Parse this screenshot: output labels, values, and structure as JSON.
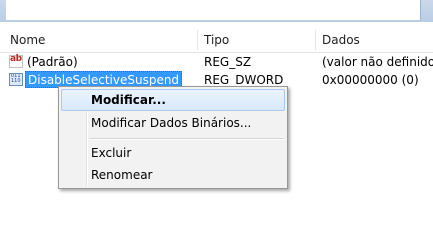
{
  "columns": {
    "name": "Nome",
    "type": "Tipo",
    "data": "Dados"
  },
  "rows": [
    {
      "name": "(Padrão)",
      "type": "REG_SZ",
      "data": "(valor não definido)",
      "icon": "string-value-icon",
      "icon_text": "ab"
    },
    {
      "name": "DisableSelectiveSuspend",
      "type": "REG_DWORD",
      "data": "0x00000000 (0)",
      "icon": "binary-value-icon",
      "icon_text": "011 110",
      "selected": true
    }
  ],
  "context_menu": {
    "items": [
      {
        "label": "Modificar...",
        "default": true,
        "highlighted": true
      },
      {
        "label": "Modificar Dados Binários..."
      },
      {
        "label": "Excluir"
      },
      {
        "label": "Renomear"
      }
    ]
  },
  "colors": {
    "selection": "#3399ff",
    "menu_background": "#f2f2f2",
    "menu_highlight_border": "#a8cbf1"
  }
}
